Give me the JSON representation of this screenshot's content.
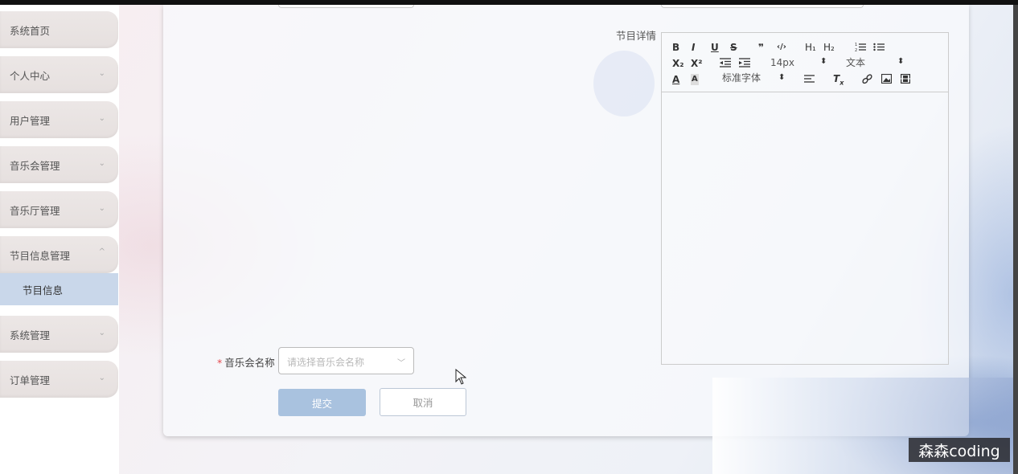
{
  "sidebar": {
    "items": [
      {
        "label": "系统首页",
        "has_chevron": false
      },
      {
        "label": "个人中心",
        "has_chevron": true
      },
      {
        "label": "用户管理",
        "has_chevron": true
      },
      {
        "label": "音乐会管理",
        "has_chevron": true
      },
      {
        "label": "音乐厅管理",
        "has_chevron": true
      },
      {
        "label": "节目信息管理",
        "has_chevron": true,
        "expanded": true
      },
      {
        "label": "系统管理",
        "has_chevron": true
      },
      {
        "label": "订单管理",
        "has_chevron": true
      }
    ],
    "active_subitem": {
      "label": "节目信息"
    },
    "chevron_down": "⌄",
    "chevron_up": "^"
  },
  "form": {
    "detail_label": "节目详情",
    "concert_label": "音乐会名称",
    "required_mark": "*",
    "concert_placeholder": "请选择音乐会名称",
    "submit_label": "提交",
    "cancel_label": "取消"
  },
  "editor": {
    "toolbar_row1": [
      "B",
      "I",
      "U",
      "S",
      "❞",
      "‹/›",
      "H₁",
      "H₂",
      "ordered-list-icon",
      "bullet-list-icon"
    ],
    "subscript": "X₂",
    "superscript": "X²",
    "font_size": "14px",
    "heading_select": "文本",
    "font_family": "标准字体"
  },
  "watermark": "森森coding",
  "colors": {
    "submit_bg": "#a9c2df",
    "active_sub_bg": "#c9d7ea",
    "required": "#e5484d"
  }
}
